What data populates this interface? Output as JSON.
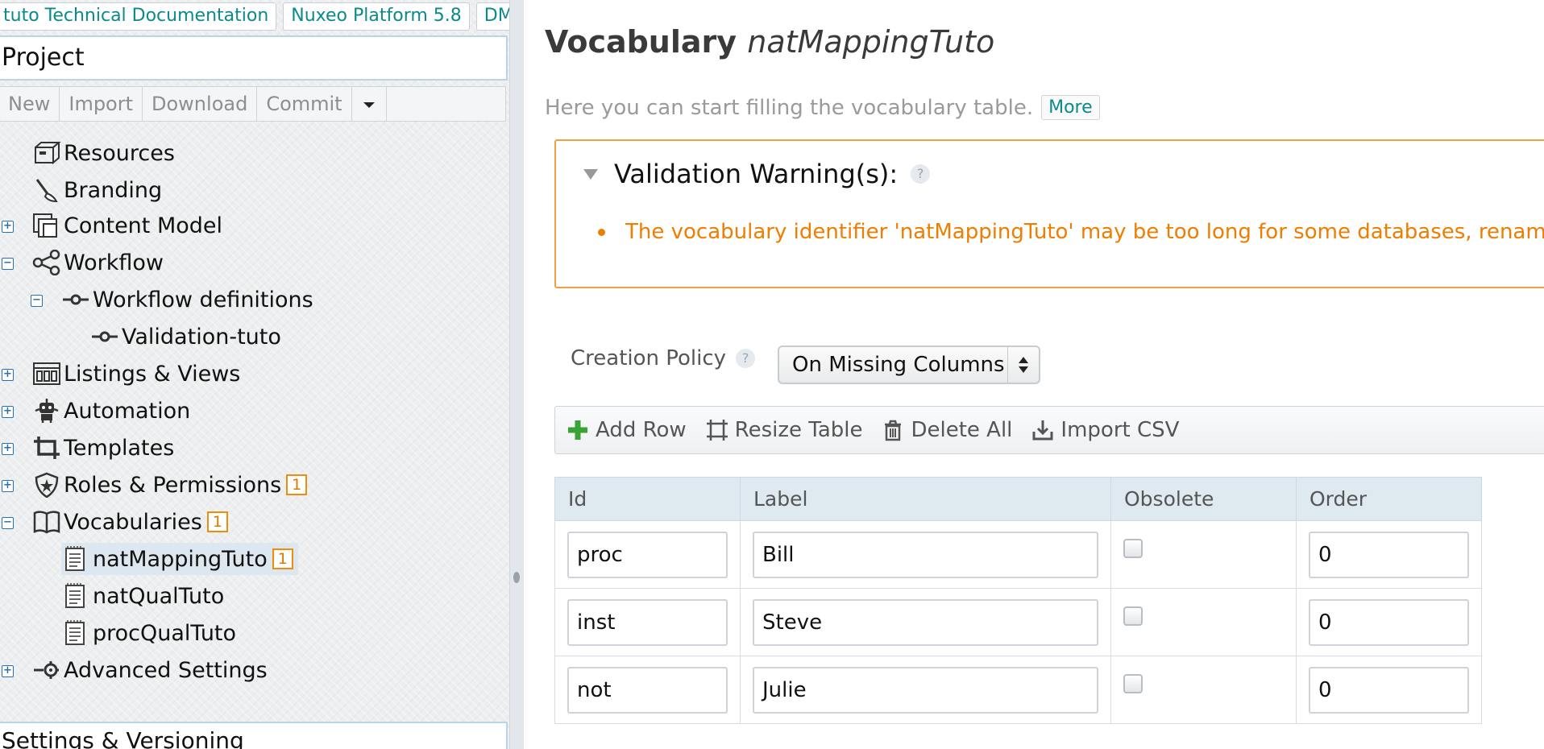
{
  "top_buttons": [
    "tuto Technical Documentation",
    "Nuxeo Platform 5.8",
    "DM"
  ],
  "project": {
    "title": "Project",
    "actions": [
      "New",
      "Import",
      "Download",
      "Commit"
    ]
  },
  "tree": [
    {
      "label": "Resources",
      "icon": "box-icon"
    },
    {
      "label": "Branding",
      "icon": "brush-icon"
    },
    {
      "label": "Content Model",
      "icon": "content-model-icon",
      "toggle": "+"
    },
    {
      "label": "Workflow",
      "icon": "share-icon",
      "toggle": "−"
    },
    {
      "label": "Workflow definitions",
      "icon": "node-icon",
      "toggle": "−"
    },
    {
      "label": "Validation-tuto",
      "icon": "node-icon"
    },
    {
      "label": "Listings & Views",
      "icon": "listings-icon",
      "toggle": "+"
    },
    {
      "label": "Automation",
      "icon": "robot-icon",
      "toggle": "+"
    },
    {
      "label": "Templates",
      "icon": "crop-icon",
      "toggle": "+"
    },
    {
      "label": "Roles & Permissions",
      "icon": "shield-icon",
      "toggle": "+",
      "badge": "1"
    },
    {
      "label": "Vocabularies",
      "icon": "book-icon",
      "toggle": "−",
      "badge": "1"
    },
    {
      "label": "natMappingTuto",
      "icon": "document-icon",
      "badge": "1",
      "selected": true
    },
    {
      "label": "natQualTuto",
      "icon": "document-icon"
    },
    {
      "label": "procQualTuto",
      "icon": "document-icon"
    },
    {
      "label": "Advanced Settings",
      "icon": "settings-node-icon",
      "toggle": "+"
    }
  ],
  "settings_label": "Settings & Versioning",
  "main": {
    "title_prefix": "Vocabulary",
    "title_name": "natMappingTuto",
    "subtitle": "Here you can start filling the vocabulary table.",
    "more_label": "More",
    "warning_title": "Validation Warning(s):",
    "help_mark": "?",
    "warning_message": "The vocabulary identifier 'natMappingTuto' may be too long for some databases, rename it t",
    "policy_label": "Creation Policy",
    "policy_value": "On Missing Columns",
    "toolbar": {
      "add_row": "Add Row",
      "resize_table": "Resize Table",
      "delete_all": "Delete All",
      "import_csv": "Import CSV"
    },
    "columns": [
      "Id",
      "Label",
      "Obsolete",
      "Order"
    ],
    "rows": [
      {
        "id": "proc",
        "label": "Bill",
        "obsolete": false,
        "order": "0"
      },
      {
        "id": "inst",
        "label": "Steve",
        "obsolete": false,
        "order": "0"
      },
      {
        "id": "not",
        "label": "Julie",
        "obsolete": false,
        "order": "0"
      }
    ]
  },
  "colors": {
    "accent_teal": "#0a8a8a",
    "warning_orange": "#ef7d00",
    "header_blue": "#dfe9f0",
    "add_green": "#3aa335"
  }
}
